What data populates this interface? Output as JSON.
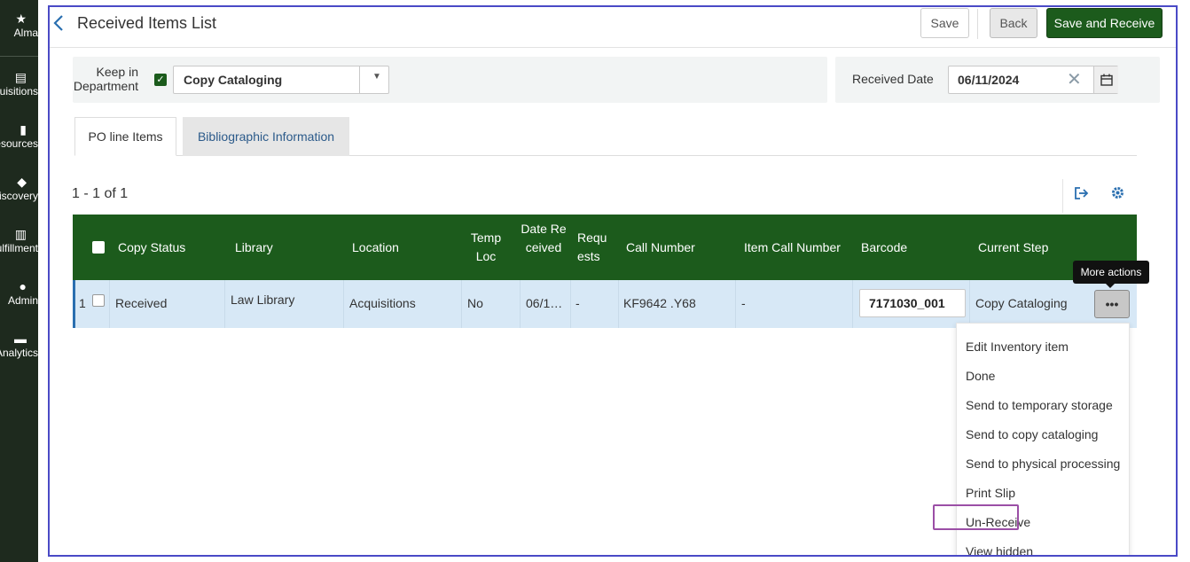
{
  "nav": {
    "items": [
      {
        "icon": "star-icon",
        "glyph": "★",
        "label": "Alma"
      },
      {
        "icon": "acquisitions-icon",
        "glyph": "▤",
        "label": "Acquisitions"
      },
      {
        "icon": "resources-icon",
        "glyph": "▮",
        "label": "Resources"
      },
      {
        "icon": "discovery-icon",
        "glyph": "◆",
        "label": "Discovery"
      },
      {
        "icon": "fulfillment-icon",
        "glyph": "▥",
        "label": "Fulfillment"
      },
      {
        "icon": "admin-icon",
        "glyph": "●",
        "label": "Admin"
      },
      {
        "icon": "analytics-icon",
        "glyph": "▬",
        "label": "Analytics"
      }
    ]
  },
  "header": {
    "title": "Received Items List",
    "save_label": "Save",
    "back_label": "Back",
    "save_receive_label": "Save and Receive"
  },
  "filters": {
    "keep_in_department_label": "Keep in Department",
    "keep_checked": true,
    "department_value": "Copy Cataloging",
    "received_date_label": "Received Date",
    "received_date_value": "06/11/2024"
  },
  "tabs": [
    {
      "label": "PO line Items",
      "active": true
    },
    {
      "label": "Bibliographic Information",
      "active": false
    }
  ],
  "results": {
    "count_text": "1 - 1 of 1"
  },
  "table": {
    "headers": {
      "copy_status": "Copy Status",
      "library": "Library",
      "location": "Location",
      "temp_loc": "Temp Loc",
      "date_received": "Date Received",
      "requests": "Requests",
      "call_number": "Call Number",
      "item_call_number": "Item Call Number",
      "barcode": "Barcode",
      "current_step": "Current Step"
    },
    "rows": [
      {
        "index": "1",
        "copy_status": "Received",
        "library": "Law Library",
        "location": "Acquisitions",
        "temp_loc": "No",
        "date_received": "06/1…",
        "requests": "-",
        "call_number": "KF9642 .Y68",
        "item_call_number": "-",
        "barcode": "7171030_001",
        "current_step": "Copy Cataloging"
      }
    ]
  },
  "tooltip": "More actions",
  "more_actions_menu": [
    "Edit Inventory item",
    "Done",
    "Send to temporary storage",
    "Send to copy cataloging",
    "Send to physical processing",
    "Print Slip",
    "Un-Receive",
    "View hidden"
  ],
  "highlighted_menu_item": "Un-Receive",
  "colors": {
    "primary_green": "#1c5b1c",
    "link_blue": "#2a6fb0",
    "row_highlight": "#d7e8f6",
    "frame_border": "#4a4ac6",
    "menu_highlight": "#9b4fa6"
  }
}
